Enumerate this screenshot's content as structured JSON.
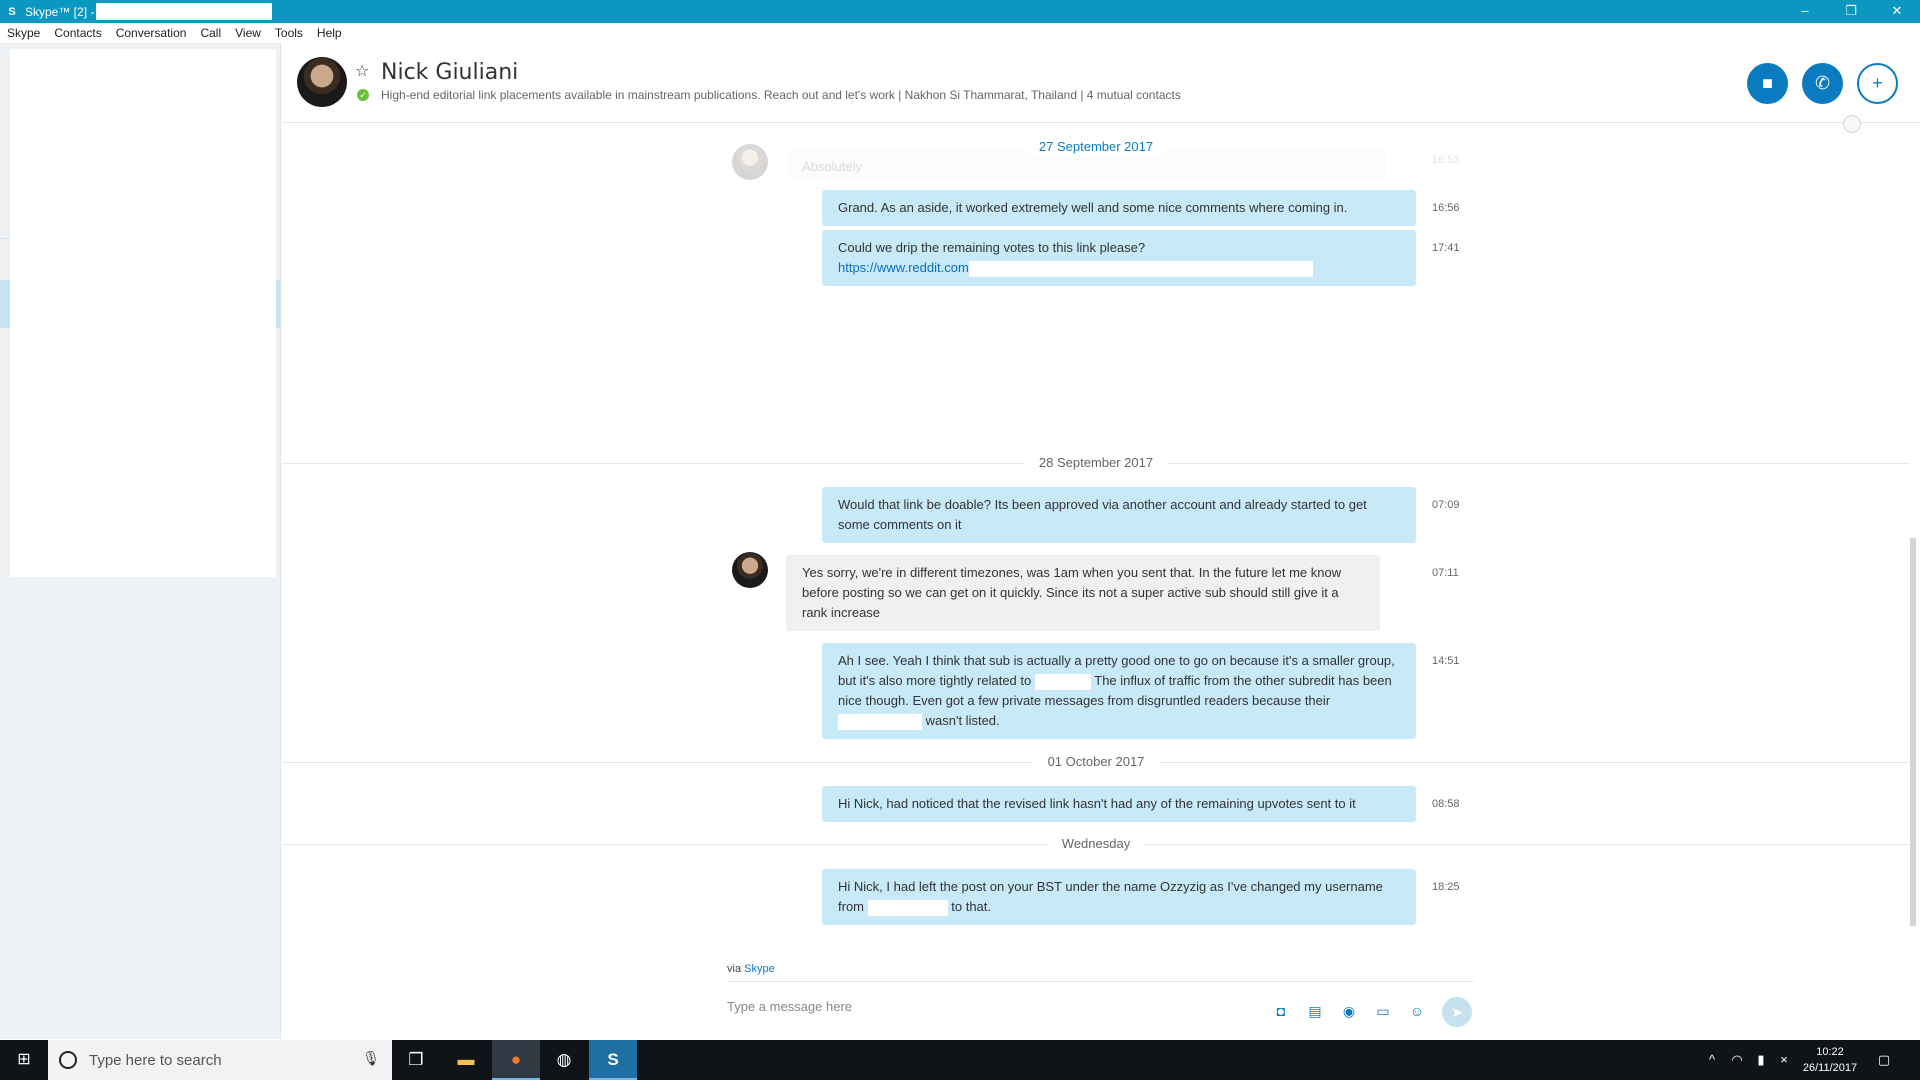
{
  "window": {
    "app_title": "Skype™ [2] -",
    "logo_glyph": "S",
    "minimize_glyph": "–",
    "restore_glyph": "❐",
    "close_glyph": "✕"
  },
  "menu": [
    "Skype",
    "Contacts",
    "Conversation",
    "Call",
    "View",
    "Tools",
    "Help"
  ],
  "header": {
    "name": "Nick Giuliani",
    "star_glyph": "☆",
    "status_glyph": "✓",
    "mood": "High-end editorial link placements available in mainstream publications. Reach out and let's work  |  Nakhon Si Thammarat, Thailand  |  4 mutual contacts",
    "video_glyph": "■",
    "call_glyph": "✆",
    "add_glyph": "+",
    "status_color": "#6bbd3c",
    "accent_color": "#0a7bc0"
  },
  "messages": {
    "faded_text": "Absolutely",
    "faded_time": "16:53",
    "dates": [
      "27 September 2017",
      "28 September 2017",
      "01 October 2017",
      "Wednesday"
    ],
    "m1": {
      "text": "Grand. As an aside, it worked extremely well and some nice comments where coming in.",
      "time": "16:56"
    },
    "m2": {
      "text": "Could we drip the remaining votes to this link please?",
      "link": "https://www.reddit.com",
      "time": "17:41"
    },
    "m3": {
      "text": "Would that link be doable? Its been approved via another account and already started to get some comments on it",
      "time": "07:09"
    },
    "m4": {
      "text": "Yes sorry, we're in different timezones, was 1am when you sent that. In the future let me know before posting so we can get on it quickly. Since its not a super active sub should still give it a rank increase",
      "time": "07:11"
    },
    "m5": {
      "text_a": "Ah I see. Yeah I think that sub is actually a pretty good one to go on because it's a smaller group, but it's also more tightly related to",
      "text_b": "The influx of traffic from the other subredit has been nice though. Even got a few private messages from disgruntled readers because their",
      "text_c": "wasn't listed.",
      "time": "14:51"
    },
    "m6": {
      "text": "Hi Nick, had noticed that the revised link hasn't had any of the remaining upvotes sent to it",
      "time": "08:58"
    },
    "m7": {
      "text_a": "Hi Nick, I had left the post on your BST under the name Ozzyzig as I've changed my username from",
      "text_b": "to that.",
      "time": "18:25"
    }
  },
  "composer": {
    "via_prefix": "via",
    "via_link": "Skype",
    "placeholder": "Type a message here",
    "tools": [
      "camera-icon",
      "file-icon",
      "video-message-icon",
      "contact-card-icon",
      "emoticon-icon"
    ],
    "tool_glyphs": [
      "◘",
      "▤",
      "◉",
      "▭",
      "☺"
    ],
    "send_glyph": "➤"
  },
  "taskbar": {
    "start_glyph": "⊞",
    "search_placeholder": "Type here to search",
    "mic_glyph": "🎙",
    "task_view_glyph": "❒",
    "explorer_glyph": "▬",
    "firefox_glyph": "●",
    "steam_glyph": "◍",
    "skype_glyph": "S",
    "tray_glyphs": [
      "^",
      "◠",
      "▮",
      "×",
      "▢"
    ],
    "time": "10:22",
    "date": "26/11/2017"
  }
}
